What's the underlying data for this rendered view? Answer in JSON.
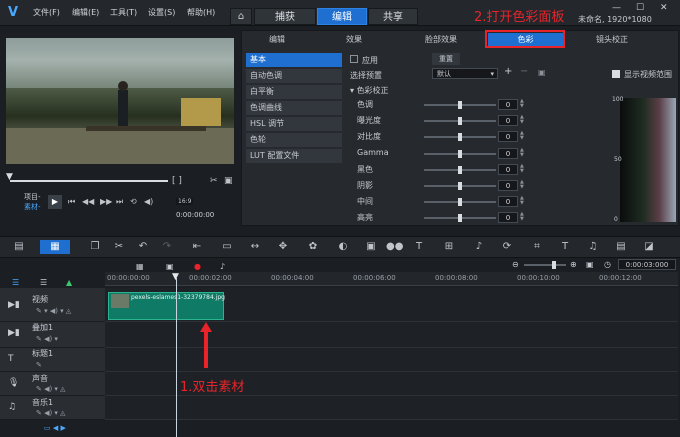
{
  "menu": [
    "文件(F)",
    "编辑(E)",
    "工具(T)",
    "设置(S)",
    "帮助(H)"
  ],
  "tabs": [
    "捕获",
    "编辑",
    "共享"
  ],
  "annotations": {
    "step2": "2.打开色彩面板",
    "step1": "1.双击素材"
  },
  "title_info": "未命名, 1920*1080",
  "subtabs": [
    "编辑",
    "效果",
    "脸部效果",
    "色彩",
    "镜头校正"
  ],
  "color_left_list": [
    "基本",
    "自动色调",
    "白平衡",
    "色调曲线",
    "HSL 调节",
    "色轮",
    "LUT 配置文件"
  ],
  "controls": {
    "apply": "应用",
    "reset": "重置",
    "select_preset": "选择预置",
    "preset_value": "默认",
    "color_correction": "色彩校正",
    "show_video_range": "显示视频范围"
  },
  "sliders": [
    {
      "label": "色调",
      "value": "0"
    },
    {
      "label": "曝光度",
      "value": "0"
    },
    {
      "label": "对比度",
      "value": "0"
    },
    {
      "label": "Gamma",
      "value": "0"
    },
    {
      "label": "黑色",
      "value": "0"
    },
    {
      "label": "阴影",
      "value": "0"
    },
    {
      "label": "中间",
      "value": "0"
    },
    {
      "label": "高亮",
      "value": "0"
    }
  ],
  "histogram": {
    "ymax": "100",
    "ymid": "50",
    "ymin": "0"
  },
  "player": {
    "project": "项目-",
    "clip": "素材-",
    "time": "0:00:00:00",
    "zoom": "16:9"
  },
  "ruler_ticks": [
    "00:00:00:00",
    "00:00:02:00",
    "00:00:04:00",
    "00:00:06:00",
    "00:00:08:00",
    "00:00:10:00",
    "00:00:12:00"
  ],
  "timecode": "0:00:03:000",
  "tracks": [
    "视频",
    "叠加1",
    "标题1",
    "声音",
    "音乐1"
  ],
  "clip": {
    "name": "pexels-eslames1-32379784.jpg"
  }
}
